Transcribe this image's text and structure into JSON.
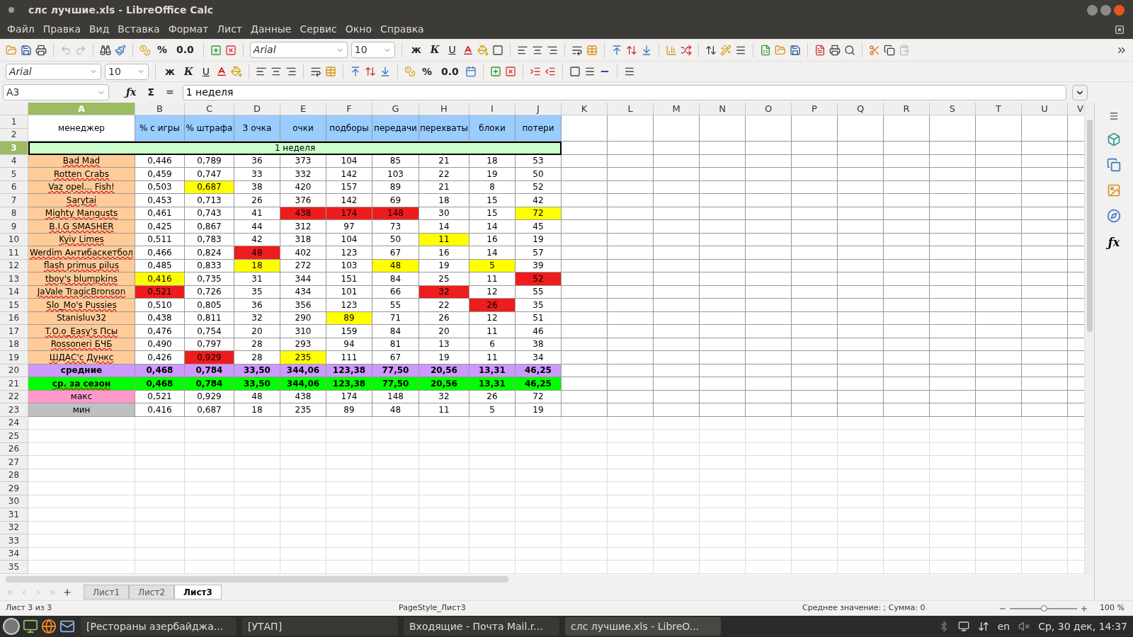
{
  "window": {
    "title": "слс лучшие.xls - LibreOffice Calc"
  },
  "menu": [
    "Файл",
    "Правка",
    "Вид",
    "Вставка",
    "Формат",
    "Лист",
    "Данные",
    "Сервис",
    "Окно",
    "Справка"
  ],
  "toolbar": {
    "percent": "%",
    "decimals": "0.0",
    "font": "Arial",
    "size": "10",
    "bold": "ж",
    "italic": "К",
    "underline": "U"
  },
  "formatting_bar": {
    "font": "Arial",
    "size": "10",
    "bold": "ж",
    "italic": "К",
    "underline": "U",
    "percent": "%",
    "decimals": "0.0"
  },
  "formula_bar": {
    "cell": "A3",
    "function_wizard": "ƒx",
    "sigma": "Σ",
    "equals": "=",
    "content": "1 неделя"
  },
  "columns": [
    {
      "label": "A",
      "selected": true
    },
    {
      "label": "B",
      "selected": false
    },
    {
      "label": "C",
      "selected": false
    },
    {
      "label": "D",
      "selected": false
    },
    {
      "label": "E",
      "selected": false
    },
    {
      "label": "F",
      "selected": false
    },
    {
      "label": "G",
      "selected": false
    },
    {
      "label": "H",
      "selected": false
    },
    {
      "label": "I",
      "selected": false
    },
    {
      "label": "J",
      "selected": false
    },
    {
      "label": "K",
      "selected": false
    },
    {
      "label": "L",
      "selected": false
    },
    {
      "label": "M",
      "selected": false
    },
    {
      "label": "N",
      "selected": false
    },
    {
      "label": "O",
      "selected": false
    },
    {
      "label": "P",
      "selected": false
    },
    {
      "label": "Q",
      "selected": false
    },
    {
      "label": "R",
      "selected": false
    },
    {
      "label": "S",
      "selected": false
    },
    {
      "label": "T",
      "selected": false
    },
    {
      "label": "U",
      "selected": false
    },
    {
      "label": "V",
      "selected": false
    }
  ],
  "header": {
    "rows": [
      "1",
      "2"
    ],
    "cells": [
      {
        "text": "менеджер",
        "color": "#ffffff"
      },
      {
        "text": "% с игры",
        "color": "#99ccff"
      },
      {
        "text": "% штрафа",
        "color": "#99ccff"
      },
      {
        "text": "3 очка",
        "color": "#99ccff"
      },
      {
        "text": "очки",
        "color": "#99ccff"
      },
      {
        "text": "подборы",
        "color": "#99ccff"
      },
      {
        "text": "передачи",
        "color": "#99ccff"
      },
      {
        "text": "перехваты",
        "color": "#99ccff"
      },
      {
        "text": "блоки",
        "color": "#99ccff"
      },
      {
        "text": "потери",
        "color": "#99ccff"
      }
    ]
  },
  "week_row": {
    "row": "3",
    "text": "1 неделя",
    "selected": true,
    "color": "#ccffcc"
  },
  "rows": [
    {
      "row": "4",
      "bold": false,
      "cells": [
        {
          "text": "Bad Mad",
          "color": "#ffcc99",
          "misspelled": true
        },
        {
          "text": "0,446"
        },
        {
          "text": "0,789"
        },
        {
          "text": "36"
        },
        {
          "text": "373"
        },
        {
          "text": "104"
        },
        {
          "text": "85"
        },
        {
          "text": "21"
        },
        {
          "text": "18"
        },
        {
          "text": "53"
        }
      ]
    },
    {
      "row": "5",
      "bold": false,
      "cells": [
        {
          "text": "Rotten Crabs",
          "color": "#ffcc99",
          "misspelled": true
        },
        {
          "text": "0,459"
        },
        {
          "text": "0,747"
        },
        {
          "text": "33"
        },
        {
          "text": "332"
        },
        {
          "text": "142"
        },
        {
          "text": "103"
        },
        {
          "text": "22"
        },
        {
          "text": "19"
        },
        {
          "text": "50"
        }
      ]
    },
    {
      "row": "6",
      "bold": false,
      "cells": [
        {
          "text": "Vaz opel... Fish!",
          "color": "#ffcc99",
          "misspelled": true
        },
        {
          "text": "0,503"
        },
        {
          "text": "0,687",
          "color": "#ffff00"
        },
        {
          "text": "38"
        },
        {
          "text": "420"
        },
        {
          "text": "157"
        },
        {
          "text": "89"
        },
        {
          "text": "21"
        },
        {
          "text": "8"
        },
        {
          "text": "52"
        }
      ]
    },
    {
      "row": "7",
      "bold": false,
      "cells": [
        {
          "text": "Sarytai",
          "color": "#ffcc99",
          "misspelled": true
        },
        {
          "text": "0,453"
        },
        {
          "text": "0,713"
        },
        {
          "text": "26"
        },
        {
          "text": "376"
        },
        {
          "text": "142"
        },
        {
          "text": "69"
        },
        {
          "text": "18"
        },
        {
          "text": "15"
        },
        {
          "text": "42"
        }
      ]
    },
    {
      "row": "8",
      "bold": false,
      "cells": [
        {
          "text": "Mighty Mangusts",
          "color": "#ffcc99",
          "misspelled": true
        },
        {
          "text": "0,461"
        },
        {
          "text": "0,743"
        },
        {
          "text": "41"
        },
        {
          "text": "438",
          "color": "#ee1c1c"
        },
        {
          "text": "174",
          "color": "#ee1c1c"
        },
        {
          "text": "148",
          "color": "#ee1c1c"
        },
        {
          "text": "30"
        },
        {
          "text": "15"
        },
        {
          "text": "72",
          "color": "#ffff00"
        }
      ]
    },
    {
      "row": "9",
      "bold": false,
      "cells": [
        {
          "text": "B.I.G SMASHER",
          "color": "#ffcc99",
          "misspelled": true
        },
        {
          "text": "0,425"
        },
        {
          "text": "0,867"
        },
        {
          "text": "44"
        },
        {
          "text": "312"
        },
        {
          "text": "97"
        },
        {
          "text": "73"
        },
        {
          "text": "14"
        },
        {
          "text": "14"
        },
        {
          "text": "45"
        }
      ]
    },
    {
      "row": "10",
      "bold": false,
      "cells": [
        {
          "text": "Kyiv Limes",
          "color": "#ffcc99",
          "misspelled": true
        },
        {
          "text": "0,511"
        },
        {
          "text": "0,783"
        },
        {
          "text": "42"
        },
        {
          "text": "318"
        },
        {
          "text": "104"
        },
        {
          "text": "50"
        },
        {
          "text": "11",
          "color": "#ffff00"
        },
        {
          "text": "16"
        },
        {
          "text": "19"
        }
      ]
    },
    {
      "row": "11",
      "bold": false,
      "cells": [
        {
          "text": "Werdim Антибаскетбол",
          "color": "#ffcc99",
          "misspelled": true
        },
        {
          "text": "0,466"
        },
        {
          "text": "0,824"
        },
        {
          "text": "48",
          "color": "#ee1c1c"
        },
        {
          "text": "402"
        },
        {
          "text": "123"
        },
        {
          "text": "67"
        },
        {
          "text": "16"
        },
        {
          "text": "14"
        },
        {
          "text": "57"
        }
      ]
    },
    {
      "row": "12",
      "bold": false,
      "cells": [
        {
          "text": "flash primus pilus",
          "color": "#ffcc99",
          "misspelled": true
        },
        {
          "text": "0,485"
        },
        {
          "text": "0,833"
        },
        {
          "text": "18",
          "color": "#ffff00"
        },
        {
          "text": "272"
        },
        {
          "text": "103"
        },
        {
          "text": "48",
          "color": "#ffff00"
        },
        {
          "text": "19"
        },
        {
          "text": "5",
          "color": "#ffff00"
        },
        {
          "text": "39"
        }
      ]
    },
    {
      "row": "13",
      "bold": false,
      "cells": [
        {
          "text": "tboy's blumpkins",
          "color": "#ffcc99",
          "misspelled": true
        },
        {
          "text": "0,416",
          "color": "#ffff00"
        },
        {
          "text": "0,735"
        },
        {
          "text": "31"
        },
        {
          "text": "344"
        },
        {
          "text": "151"
        },
        {
          "text": "84"
        },
        {
          "text": "25"
        },
        {
          "text": "11"
        },
        {
          "text": "52",
          "color": "#ee1c1c"
        }
      ]
    },
    {
      "row": "14",
      "bold": false,
      "cells": [
        {
          "text": "JaVale TragicBronson",
          "color": "#ffcc99",
          "misspelled": true
        },
        {
          "text": "0,521",
          "color": "#ee1c1c"
        },
        {
          "text": "0,726"
        },
        {
          "text": "35"
        },
        {
          "text": "434"
        },
        {
          "text": "101"
        },
        {
          "text": "66"
        },
        {
          "text": "32",
          "color": "#ee1c1c"
        },
        {
          "text": "12"
        },
        {
          "text": "55"
        }
      ]
    },
    {
      "row": "15",
      "bold": false,
      "cells": [
        {
          "text": "Slo_Mo's Pussies",
          "color": "#ffcc99",
          "misspelled": true
        },
        {
          "text": "0,510"
        },
        {
          "text": "0,805"
        },
        {
          "text": "36"
        },
        {
          "text": "356"
        },
        {
          "text": "123"
        },
        {
          "text": "55"
        },
        {
          "text": "22"
        },
        {
          "text": "26",
          "color": "#ee1c1c"
        },
        {
          "text": "35"
        }
      ]
    },
    {
      "row": "16",
      "bold": false,
      "cells": [
        {
          "text": "Stanisluv32",
          "color": "#ffcc99",
          "misspelled": false
        },
        {
          "text": "0,438"
        },
        {
          "text": "0,811"
        },
        {
          "text": "32"
        },
        {
          "text": "290"
        },
        {
          "text": "89",
          "color": "#ffff00"
        },
        {
          "text": "71"
        },
        {
          "text": "26"
        },
        {
          "text": "12"
        },
        {
          "text": "51"
        }
      ]
    },
    {
      "row": "17",
      "bold": false,
      "cells": [
        {
          "text": "T.O.o_Easy's Псы",
          "color": "#ffcc99",
          "misspelled": true
        },
        {
          "text": "0,476"
        },
        {
          "text": "0,754"
        },
        {
          "text": "20"
        },
        {
          "text": "310"
        },
        {
          "text": "159"
        },
        {
          "text": "84"
        },
        {
          "text": "20"
        },
        {
          "text": "11"
        },
        {
          "text": "46"
        }
      ]
    },
    {
      "row": "18",
      "bold": false,
      "cells": [
        {
          "text": "Rossoneri БЧБ",
          "color": "#ffcc99",
          "misspelled": true
        },
        {
          "text": "0,490"
        },
        {
          "text": "0,797"
        },
        {
          "text": "28"
        },
        {
          "text": "293"
        },
        {
          "text": "94"
        },
        {
          "text": "81"
        },
        {
          "text": "13"
        },
        {
          "text": "6"
        },
        {
          "text": "38"
        }
      ]
    },
    {
      "row": "19",
      "bold": false,
      "cells": [
        {
          "text": "ШДАС'с Дункс",
          "color": "#ffcc99",
          "misspelled": true
        },
        {
          "text": "0,426"
        },
        {
          "text": "0,929",
          "color": "#ee1c1c"
        },
        {
          "text": "28"
        },
        {
          "text": "235",
          "color": "#ffff00"
        },
        {
          "text": "111"
        },
        {
          "text": "67"
        },
        {
          "text": "19"
        },
        {
          "text": "11"
        },
        {
          "text": "34"
        }
      ]
    },
    {
      "row": "20",
      "bold": true,
      "cells": [
        {
          "text": "средние",
          "color": "#cc99ff"
        },
        {
          "text": "0,468",
          "color": "#cc99ff"
        },
        {
          "text": "0,784",
          "color": "#cc99ff"
        },
        {
          "text": "33,50",
          "color": "#cc99ff"
        },
        {
          "text": "344,06",
          "color": "#cc99ff"
        },
        {
          "text": "123,38",
          "color": "#cc99ff"
        },
        {
          "text": "77,50",
          "color": "#cc99ff"
        },
        {
          "text": "20,56",
          "color": "#cc99ff"
        },
        {
          "text": "13,31",
          "color": "#cc99ff"
        },
        {
          "text": "46,25",
          "color": "#cc99ff"
        }
      ]
    },
    {
      "row": "21",
      "bold": true,
      "cells": [
        {
          "text": "ср. за сезон",
          "color": "#00ff00",
          "misspelled": true
        },
        {
          "text": "0,468",
          "color": "#00ff00"
        },
        {
          "text": "0,784",
          "color": "#00ff00"
        },
        {
          "text": "33,50",
          "color": "#00ff00"
        },
        {
          "text": "344,06",
          "color": "#00ff00"
        },
        {
          "text": "123,38",
          "color": "#00ff00"
        },
        {
          "text": "77,50",
          "color": "#00ff00"
        },
        {
          "text": "20,56",
          "color": "#00ff00"
        },
        {
          "text": "13,31",
          "color": "#00ff00"
        },
        {
          "text": "46,25",
          "color": "#00ff00"
        }
      ]
    },
    {
      "row": "22",
      "bold": false,
      "cells": [
        {
          "text": "макс",
          "color": "#ff99cc"
        },
        {
          "text": "0,521"
        },
        {
          "text": "0,929"
        },
        {
          "text": "48"
        },
        {
          "text": "438"
        },
        {
          "text": "174"
        },
        {
          "text": "148"
        },
        {
          "text": "32"
        },
        {
          "text": "26"
        },
        {
          "text": "72"
        }
      ]
    },
    {
      "row": "23",
      "bold": false,
      "cells": [
        {
          "text": "мин",
          "color": "#c0c0c0"
        },
        {
          "text": "0,416"
        },
        {
          "text": "0,687"
        },
        {
          "text": "18"
        },
        {
          "text": "235"
        },
        {
          "text": "89"
        },
        {
          "text": "48"
        },
        {
          "text": "11"
        },
        {
          "text": "5"
        },
        {
          "text": "19"
        }
      ]
    }
  ],
  "empty_rows": [
    "24",
    "25",
    "26",
    "27",
    "28",
    "29",
    "30",
    "31",
    "32",
    "33",
    "34",
    "35"
  ],
  "sheet_tabs": [
    {
      "label": "Лист1",
      "selected": false
    },
    {
      "label": "Лист2",
      "selected": false
    },
    {
      "label": "Лист3",
      "selected": true
    }
  ],
  "status_bar": {
    "sheet": "Лист 3 из 3",
    "page_style": "PageStyle_Лист3",
    "summary": "Среднее значение: ; Сумма: 0",
    "zoom": "100 %",
    "zoom_slider": {
      "level": 0.5
    }
  },
  "sidebar": {
    "functions": "ƒx"
  },
  "taskbar": {
    "windows": [
      {
        "label": "[Рестораны азербайджа...",
        "selected": false
      },
      {
        "label": "[УТАП]",
        "selected": false
      },
      {
        "label": "Входящие - Почта Mail.r...",
        "selected": false
      },
      {
        "label": "слс лучшие.xls - LibreO...",
        "selected": true
      }
    ],
    "language": "en",
    "clock": "Ср, 30 дек, 14:37"
  }
}
